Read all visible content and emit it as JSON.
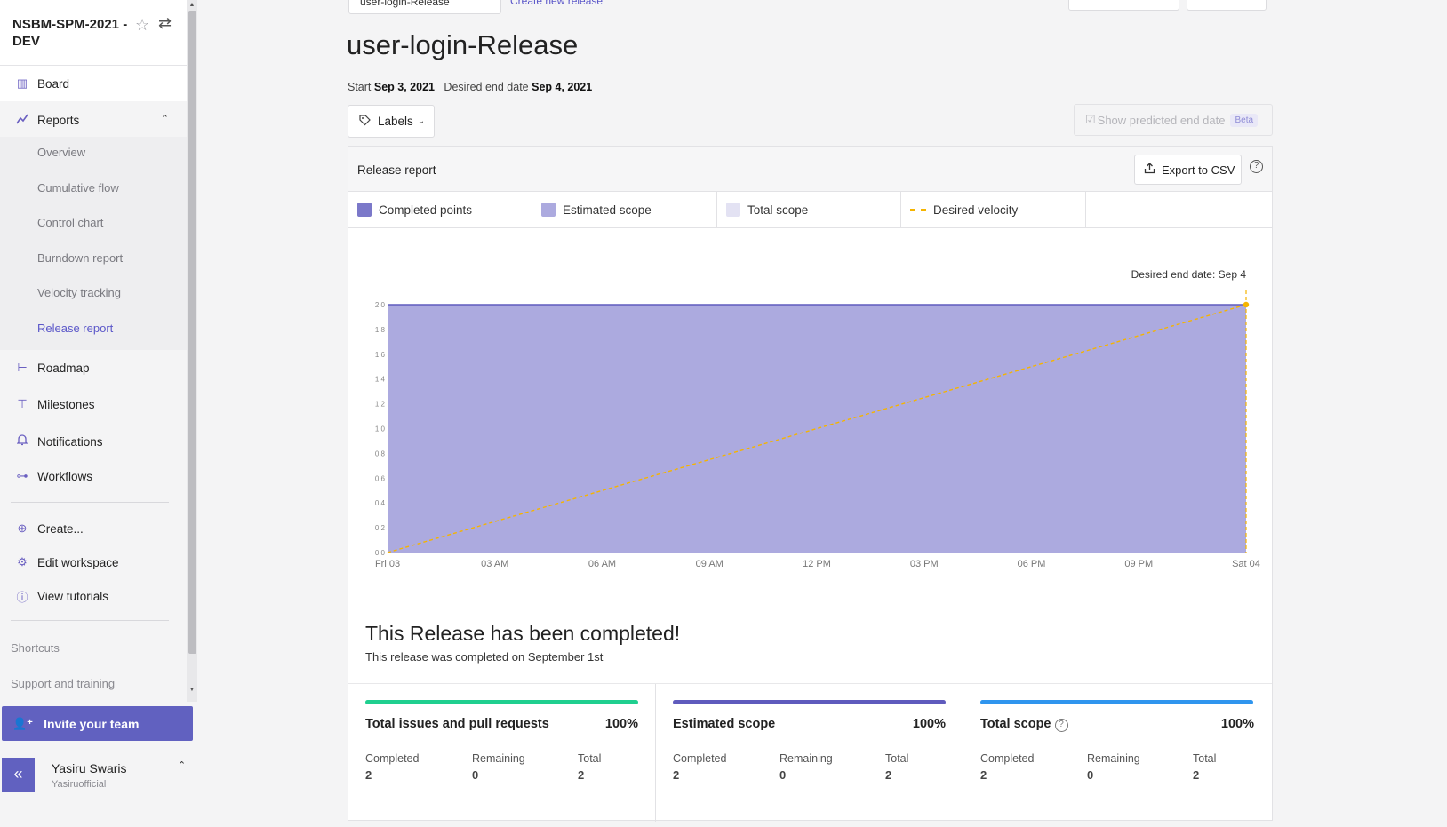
{
  "workspace": {
    "title": "NSBM-SPM-2021 - DEV",
    "star_icon": "star-icon",
    "switch_icon": "switch-icon"
  },
  "sidebar": {
    "board": "Board",
    "reports": "Reports",
    "report_items": [
      "Overview",
      "Cumulative flow",
      "Control chart",
      "Burndown report",
      "Velocity tracking",
      "Release report"
    ],
    "roadmap": "Roadmap",
    "milestones": "Milestones",
    "notifications": "Notifications",
    "workflows": "Workflows",
    "create": "Create...",
    "edit_workspace": "Edit workspace",
    "view_tutorials": "View tutorials",
    "shortcuts": "Shortcuts",
    "support": "Support and training",
    "invite": "Invite your team",
    "collapse": "«"
  },
  "user": {
    "name": "Yasiru Swaris",
    "handle": "Yasiruofficial"
  },
  "top": {
    "tab": "user-login-Release",
    "link": "Create new release"
  },
  "page": {
    "title": "user-login-Release",
    "start_label": "Start",
    "start_date": "Sep 3, 2021",
    "end_label": "Desired end date",
    "end_date": "Sep 4, 2021",
    "labels_button": "Labels",
    "predict_button": "Show predicted end date",
    "beta": "Beta"
  },
  "report": {
    "title": "Release report",
    "export": "Export to CSV",
    "legend": [
      "Completed points",
      "Estimated scope",
      "Total scope",
      "Desired velocity"
    ],
    "completed_title": "This Release has been completed!",
    "completed_sub": "This release was completed on September 1st"
  },
  "colors": {
    "completed": "#7b78c9",
    "estimated": "#acaadf",
    "total_scope": "#e3e2f3",
    "velocity": "#f5b400",
    "green": "#1fcf8f",
    "purple": "#5f5bbd",
    "blue": "#2f95ee"
  },
  "chart_data": {
    "type": "area",
    "title": "",
    "annotation": "Desired end date: Sep 4",
    "x": [
      "Fri 03",
      "03 AM",
      "06 AM",
      "09 AM",
      "12 PM",
      "03 PM",
      "06 PM",
      "09 PM",
      "Sat 04"
    ],
    "y_ticks": [
      "0.0",
      "0.2",
      "0.4",
      "0.6",
      "0.8",
      "1.0",
      "1.2",
      "1.4",
      "1.6",
      "1.8",
      "2.0"
    ],
    "ylim": [
      0,
      2
    ],
    "series": [
      {
        "name": "Estimated scope",
        "values": [
          2,
          2,
          2,
          2,
          2,
          2,
          2,
          2,
          2
        ]
      },
      {
        "name": "Desired velocity",
        "values": [
          0,
          0.25,
          0.5,
          0.75,
          1,
          1.25,
          1.5,
          1.75,
          2
        ]
      }
    ]
  },
  "stats": [
    {
      "title": "Total issues and pull requests",
      "pct": "100%",
      "completed": "2",
      "remaining": "0",
      "total": "2",
      "help": false
    },
    {
      "title": "Estimated scope",
      "pct": "100%",
      "completed": "2",
      "remaining": "0",
      "total": "2",
      "help": false
    },
    {
      "title": "Total scope",
      "pct": "100%",
      "completed": "2",
      "remaining": "0",
      "total": "2",
      "help": true
    }
  ],
  "stat_labels": {
    "completed": "Completed",
    "remaining": "Remaining",
    "total": "Total"
  }
}
